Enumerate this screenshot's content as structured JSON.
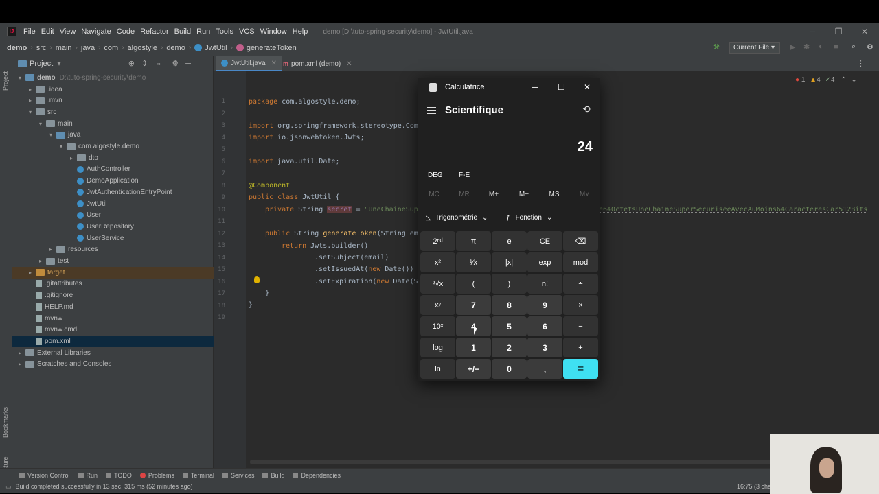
{
  "ide": {
    "menu": [
      "File",
      "Edit",
      "View",
      "Navigate",
      "Code",
      "Refactor",
      "Build",
      "Run",
      "Tools",
      "VCS",
      "Window",
      "Help"
    ],
    "window_title": "demo [D:\\tuto-spring-security\\demo] - JwtUtil.java",
    "breadcrumb": [
      "demo",
      "src",
      "main",
      "java",
      "com",
      "algostyle",
      "demo",
      "JwtUtil",
      "generateToken"
    ],
    "run_config": "Current File",
    "project_panel_title": "Project",
    "tree": [
      {
        "label": "demo",
        "dim": "D:\\tuto-spring-security\\demo",
        "indent": 0,
        "kind": "folder-blue",
        "arrow": "▾",
        "bold": true
      },
      {
        "label": ".idea",
        "indent": 1,
        "kind": "folder",
        "arrow": "▸"
      },
      {
        "label": ".mvn",
        "indent": 1,
        "kind": "folder",
        "arrow": "▸"
      },
      {
        "label": "src",
        "indent": 1,
        "kind": "folder",
        "arrow": "▾"
      },
      {
        "label": "main",
        "indent": 2,
        "kind": "folder",
        "arrow": "▾"
      },
      {
        "label": "java",
        "indent": 3,
        "kind": "folder-blue",
        "arrow": "▾"
      },
      {
        "label": "com.algostyle.demo",
        "indent": 4,
        "kind": "folder",
        "arrow": "▾"
      },
      {
        "label": "dto",
        "indent": 5,
        "kind": "folder",
        "arrow": "▸"
      },
      {
        "label": "AuthController",
        "indent": 5,
        "kind": "class"
      },
      {
        "label": "DemoApplication",
        "indent": 5,
        "kind": "class"
      },
      {
        "label": "JwtAuthenticationEntryPoint",
        "indent": 5,
        "kind": "class"
      },
      {
        "label": "JwtUtil",
        "indent": 5,
        "kind": "class"
      },
      {
        "label": "User",
        "indent": 5,
        "kind": "class"
      },
      {
        "label": "UserRepository",
        "indent": 5,
        "kind": "class"
      },
      {
        "label": "UserService",
        "indent": 5,
        "kind": "class"
      },
      {
        "label": "resources",
        "indent": 3,
        "kind": "folder",
        "arrow": "▸"
      },
      {
        "label": "test",
        "indent": 2,
        "kind": "folder",
        "arrow": "▸"
      },
      {
        "label": "target",
        "indent": 1,
        "kind": "folder-orange",
        "arrow": "▸",
        "target": true
      },
      {
        "label": ".gitattributes",
        "indent": 1,
        "kind": "file"
      },
      {
        "label": ".gitignore",
        "indent": 1,
        "kind": "file"
      },
      {
        "label": "HELP.md",
        "indent": 1,
        "kind": "file"
      },
      {
        "label": "mvnw",
        "indent": 1,
        "kind": "file"
      },
      {
        "label": "mvnw.cmd",
        "indent": 1,
        "kind": "file"
      },
      {
        "label": "pom.xml",
        "indent": 1,
        "kind": "file",
        "selected": true
      },
      {
        "label": "External Libraries",
        "indent": 0,
        "kind": "folder",
        "arrow": "▸"
      },
      {
        "label": "Scratches and Consoles",
        "indent": 0,
        "kind": "folder",
        "arrow": "▸"
      }
    ],
    "tabs": [
      "JwtUtil.java",
      "pom.xml (demo)"
    ],
    "line_numbers": [
      "1",
      "2",
      "3",
      "4",
      "5",
      "6",
      "7",
      "8",
      "9",
      "10",
      "11",
      "12",
      "13",
      "14",
      "15",
      "16",
      "17",
      "18",
      "19"
    ],
    "code": {
      "l1_kw": "package ",
      "l1": "com.algostyle.demo;",
      "l3_kw": "import ",
      "l3": "org.springframework.stereotype.Com",
      "l4_kw": "import ",
      "l4": "io.jsonwebtoken.Jwts;",
      "l6_kw": "import ",
      "l6": "java.util.Date;",
      "l8": "@Component",
      "l9_kw": "public class ",
      "l9": "JwtUtil {",
      "l10_kw": "private ",
      "l10_type": "String ",
      "l10_fld": "secret",
      "l10_eq": " = ",
      "l10_str": "\"UneChaineSup",
      "l10_tail": "e64OctetsUneChaineSuperSecuriseeAvecAuMoins64CaracteresCar512Bits",
      "l12_kw": "public ",
      "l12": "String ",
      "l12_m": "generateToken",
      "l12_b": "(String em",
      "l13_kw": "return ",
      "l13": "Jwts.builder()",
      "l14": ".setSubject(email)",
      "l15": ".setIssuedAt(",
      "l15_kw": "new ",
      "l15_b": "Date())",
      "l16": ".setExpiration(",
      "l16_kw": "new ",
      "l16_b": "Date(S",
      "l17": "}",
      "l18": "}"
    },
    "inspections": {
      "errors": "1",
      "warnings": "4",
      "weak": "4"
    },
    "bottom_tools": [
      "Version Control",
      "Run",
      "TODO",
      "Problems",
      "Terminal",
      "Services",
      "Build",
      "Dependencies"
    ],
    "status_message": "Build completed successfully in 13 sec, 315 ms (52 minutes ago)",
    "caret_position": "16:75 (3 cha"
  },
  "calculator": {
    "title": "Calculatrice",
    "mode": "Scientifique",
    "display": "24",
    "angle_unit": "DEG",
    "fe_label": "F-E",
    "memory": [
      "MC",
      "MR",
      "M+",
      "M−",
      "MS",
      "M˅"
    ],
    "trig_label": "Trigonométrie",
    "func_label": "Fonction",
    "keys": [
      [
        "2ⁿᵈ",
        "π",
        "e",
        "CE",
        "⌫"
      ],
      [
        "x²",
        "¹⁄x",
        "|x|",
        "exp",
        "mod"
      ],
      [
        "²√x",
        "(",
        ")",
        "n!",
        "÷"
      ],
      [
        "xʸ",
        "7",
        "8",
        "9",
        "×"
      ],
      [
        "10ˣ",
        "4",
        "5",
        "6",
        "−"
      ],
      [
        "log",
        "1",
        "2",
        "3",
        "+"
      ],
      [
        "ln",
        "+/−",
        "0",
        ",",
        "="
      ]
    ],
    "equals_color": "#3fe0f2"
  },
  "colors": {
    "ide_bg": "#2b2b2b",
    "panel_bg": "#3c3f41",
    "accent": "#4a88c7"
  }
}
